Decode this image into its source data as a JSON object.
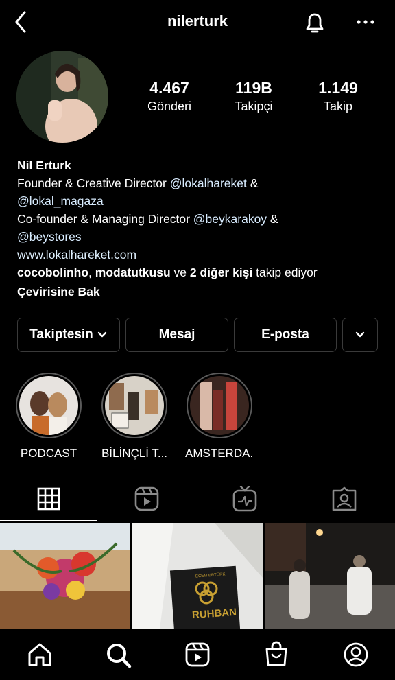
{
  "header": {
    "username": "nilerturk",
    "back_icon": "chevron-left-icon",
    "notification_icon": "bell-icon",
    "more_icon": "more-horizontal-icon"
  },
  "stats": [
    {
      "value": "4.467",
      "label": "Gönderi"
    },
    {
      "value": "119B",
      "label": "Takipçi"
    },
    {
      "value": "1.149",
      "label": "Takip"
    }
  ],
  "bio": {
    "name": "Nil Erturk",
    "line1_prefix": "Founder & Creative Director ",
    "line1_mention": "@lokalhareket",
    "line1_suffix": " &",
    "line2_mention": "@lokal_magaza",
    "line3_prefix": "Co-founder & Managing Director ",
    "line3_mention": "@beykarakoy",
    "line3_suffix": " &",
    "line4_mention": "@beystores",
    "website": "www.lokalhareket.com",
    "followed_by_1": "cocobolinho",
    "followed_by_sep": ", ",
    "followed_by_2": "modatutkusu",
    "followed_by_and": " ve ",
    "followed_by_others": "2 diğer kişi",
    "followed_by_suffix": " takip ediyor",
    "translate": "Çevirisine Bak"
  },
  "buttons": {
    "following": "Takiptesin",
    "message": "Mesaj",
    "email": "E-posta"
  },
  "highlights": [
    {
      "label": "PODCAST"
    },
    {
      "label": "BİLİNÇLİ T..."
    },
    {
      "label": "AMSTERDA..."
    }
  ],
  "tabs": [
    "grid-icon",
    "reels-icon",
    "igtv-icon",
    "tagged-icon"
  ],
  "nav": [
    "home-icon",
    "search-icon",
    "reels-icon",
    "shop-icon",
    "profile-icon"
  ],
  "posts": [
    {
      "text": ""
    },
    {
      "book_author": "ECEM ERTÜRK",
      "book_title": "RUHBAN"
    },
    {
      "text": ""
    }
  ],
  "colors": {
    "background": "#000000",
    "text": "#ffffff",
    "border": "#3a3a3a",
    "link": "#e0f1ff"
  }
}
